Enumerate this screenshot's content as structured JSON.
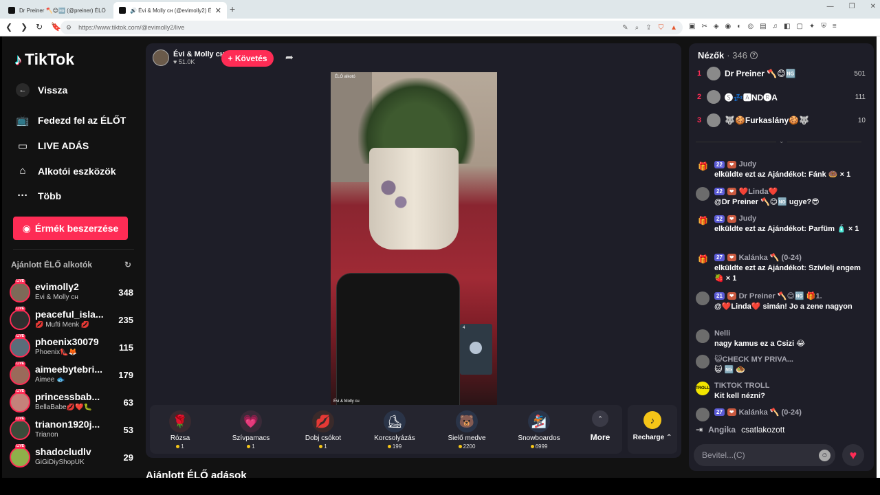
{
  "browser": {
    "tabs": [
      {
        "label": "Dr Preiner 🪓😊🆖 (@preiner) ÉLŐ",
        "active": false
      },
      {
        "label": "🔊 Évi & Molly ᴄʜ (@evimolly2) É",
        "active": true
      }
    ],
    "url": "https://www.tiktok.com/@evimolly2/live"
  },
  "sidebar": {
    "logo": "TikTok",
    "menu": [
      {
        "icon": "arrow-left-icon",
        "label": "Vissza"
      },
      {
        "icon": "tv-icon",
        "label": "Fedezd fel az ÉLŐT"
      },
      {
        "icon": "video-camera-icon",
        "label": "LIVE ADÁS"
      },
      {
        "icon": "creator-tools-icon",
        "label": "Alkotói eszközök"
      },
      {
        "icon": "more-dots-icon",
        "label": "Több"
      }
    ],
    "coins_button": "Érmék beszerzése",
    "recommended_heading": "Ajánlott ÉLŐ alkotók",
    "live_badge": "LIVE",
    "creators": [
      {
        "name": "evimolly2",
        "sub": "Évi & Molly ᴄʜ",
        "count": "348",
        "color": "#7d6a58"
      },
      {
        "name": "peaceful_isla...",
        "sub": "💋 Mufti Menk 💋",
        "count": "235",
        "color": "#2f2f2f"
      },
      {
        "name": "phoenix30079",
        "sub": "Phoenix👠🦊",
        "count": "115",
        "color": "#5a6d7a"
      },
      {
        "name": "aimeebytebri...",
        "sub": "Aimee 🐟",
        "count": "179",
        "color": "#9a6a5a"
      },
      {
        "name": "princessbab...",
        "sub": "BellaBabe💋❤️🐛",
        "count": "63",
        "color": "#c4827a"
      },
      {
        "name": "trianon1920j...",
        "sub": "Trianon",
        "count": "53",
        "color": "#3b4b3a"
      },
      {
        "name": "shadocludlv",
        "sub": "GiGiDiyShopUK",
        "count": "29",
        "color": "#8fb04a"
      }
    ]
  },
  "stream": {
    "host_name": "Évi & Molly ᴄʜ",
    "host_likes": "51.0K",
    "follow_label": "+ Követés",
    "video_label_top": "ÉLŐ alkotó",
    "video_label_bottom": "Évi & Molly ᴄʜ",
    "pip_text": "4",
    "gifts": [
      {
        "name": "Rózsa",
        "price": "1",
        "icon": "🌹",
        "color": "#3a2a30"
      },
      {
        "name": "Szívpamacs",
        "price": "1",
        "icon": "💗",
        "color": "#3a2a38"
      },
      {
        "name": "Dobj csókot",
        "price": "1",
        "icon": "💋",
        "color": "#3a2a2a"
      },
      {
        "name": "Korcsolyázás",
        "price": "199",
        "icon": "⛸",
        "color": "#2a3448"
      },
      {
        "name": "Sielő medve",
        "price": "2200",
        "icon": "🐻",
        "color": "#2a3448"
      },
      {
        "name": "Snowboardos",
        "price": "6999",
        "icon": "🏂",
        "color": "#2a3448"
      }
    ],
    "more_label": "More",
    "recharge_label": "Recharge ⌃"
  },
  "below_title": "Ajánlott ÉLŐ adások",
  "chat": {
    "viewers_label": "Nézők",
    "viewers_count": "· 346",
    "top_viewers": [
      {
        "rank": "1",
        "name": "Dr Preiner 🪓😊🆖",
        "score": "501"
      },
      {
        "rank": "2",
        "name": "🅢💤🅰ND🅡A",
        "score": "111"
      },
      {
        "rank": "3",
        "name": "🐺🍪Furkaslány🍪🐺",
        "score": "10"
      }
    ],
    "messages": [
      {
        "type": "gift",
        "level": "22",
        "name": "Judy",
        "text": "elküldte ezt az Ajándékot: Fánk 🍩 × 1"
      },
      {
        "type": "avatar",
        "level": "22",
        "name": "❤️Linda❤️",
        "text": "@Dr Preiner 🪓😊🆖 ugye?😎"
      },
      {
        "type": "gift",
        "level": "22",
        "name": "Judy",
        "text": "elküldte ezt az Ajándékot: Parfüm 🧴 × 1"
      },
      {
        "type": "gift",
        "level": "27",
        "name": "Kalánka 🪓 (0-24)",
        "text": "elküldte ezt az Ajándékot: Szívlelj engem 🍓 × 1"
      },
      {
        "type": "avatar",
        "level": "21",
        "name": "Dr Preiner 🪓😊🆖 🎁1.",
        "text": "@❤️Linda❤️ simán! Jo a zene nagyon"
      },
      {
        "type": "avatar",
        "level": "",
        "name": "Nelli",
        "text": "nagy kamus ez a Csizi 😂"
      },
      {
        "type": "avatar",
        "level": "",
        "name": "😺CHECK MY PRIVA...",
        "text": "😺 🆖 🧆"
      },
      {
        "type": "troll",
        "level": "",
        "name": "TIKTOK TROLL",
        "text": "Kit kell nézni?"
      },
      {
        "type": "avatar",
        "level": "27",
        "name": "Kalánka 🪓 (0-24)",
        "text": ""
      }
    ],
    "troll_avatar": "TROLL",
    "joined_name": "Angika",
    "joined_text": "csatlakozott",
    "input_placeholder": "Bevitel...(C)"
  }
}
